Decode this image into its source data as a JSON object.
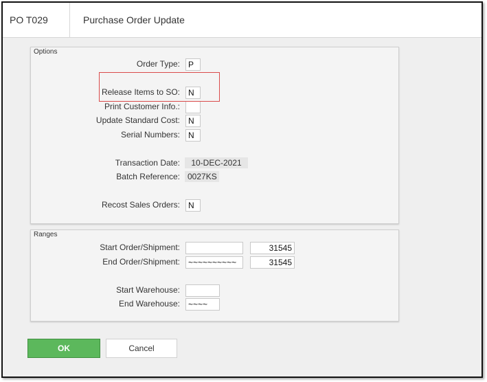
{
  "window": {
    "program_code": "PO T029",
    "title": "Purchase Order Update"
  },
  "options": {
    "section_title": "Options",
    "order_type": {
      "label": "Order Type:",
      "value": "P"
    },
    "release_items_to_so": {
      "label": "Release Items to SO:",
      "value": "N"
    },
    "print_customer_info": {
      "label": "Print Customer Info.:",
      "value": ""
    },
    "update_standard_cost": {
      "label": "Update Standard Cost:",
      "value": "N"
    },
    "serial_numbers": {
      "label": "Serial Numbers:",
      "value": "N"
    },
    "transaction_date": {
      "label": "Transaction Date:",
      "value": "10-DEC-2021"
    },
    "batch_reference": {
      "label": "Batch Reference:",
      "value": "0027KS"
    },
    "recost_sales_orders": {
      "label": "Recost Sales Orders:",
      "value": "N"
    }
  },
  "ranges": {
    "section_title": "Ranges",
    "start_order_shipment": {
      "label": "Start Order/Shipment:",
      "value1": "",
      "value2": "31545"
    },
    "end_order_shipment": {
      "label": "End Order/Shipment:",
      "value1": "~~~~~~~~~~",
      "value2": "31545"
    },
    "start_warehouse": {
      "label": "Start Warehouse:",
      "value": ""
    },
    "end_warehouse": {
      "label": "End Warehouse:",
      "value": "~~~~"
    }
  },
  "buttons": {
    "ok_label": "OK",
    "cancel_label": "Cancel"
  },
  "colors": {
    "ok_button": "#5cb85c",
    "highlight_border": "#d94a4a"
  }
}
